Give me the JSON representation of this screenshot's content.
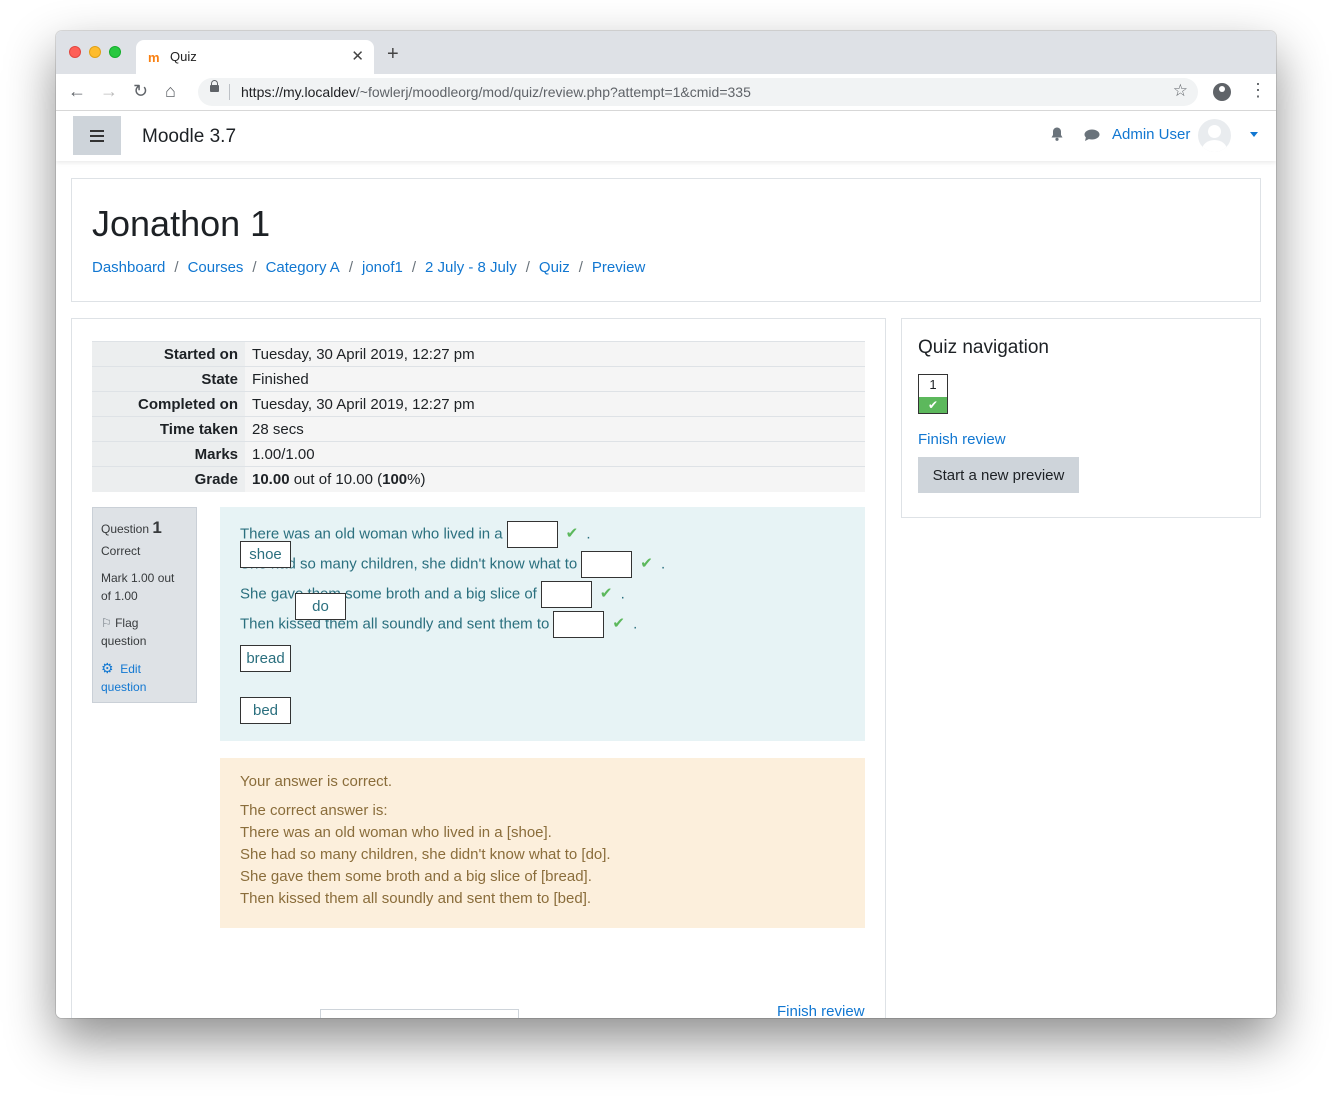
{
  "browser": {
    "tab_title": "Quiz",
    "favicon": "moodle-icon",
    "url_host": "https://my.localdev",
    "url_path": "/~fowlerj/moodleorg/mod/quiz/review.php?attempt=1&cmid=335"
  },
  "navbar": {
    "site_name": "Moodle 3.7",
    "user_name": "Admin User"
  },
  "header": {
    "title": "Jonathon 1",
    "breadcrumb": [
      "Dashboard",
      "Courses",
      "Category A",
      "jonof1",
      "2 July - 8 July",
      "Quiz",
      "Preview"
    ]
  },
  "summary": [
    {
      "label": "Started on",
      "value": "Tuesday, 30 April 2019, 12:27 pm"
    },
    {
      "label": "State",
      "value": "Finished"
    },
    {
      "label": "Completed on",
      "value": "Tuesday, 30 April 2019, 12:27 pm"
    },
    {
      "label": "Time taken",
      "value": "28 secs"
    },
    {
      "label": "Marks",
      "value": "1.00/1.00"
    },
    {
      "label": "Grade",
      "grade_value": "10.00",
      "grade_mid": " out of 10.00 (",
      "grade_pct": "100",
      "grade_end": "%)"
    }
  ],
  "question": {
    "prefix": "Question",
    "number": "1",
    "state": "Correct",
    "mark": "Mark 1.00 out of 1.00",
    "flag": "Flag question",
    "edit": "Edit question",
    "lines": [
      {
        "pre": "There was an old woman who lived in a",
        "post": "."
      },
      {
        "pre": "She had so many children, she didn't know what to",
        "post": "."
      },
      {
        "pre": "She gave them some broth and a big slice of",
        "post": "."
      },
      {
        "pre": "Then kissed them all soundly and sent them to",
        "post": "."
      }
    ],
    "drag_items": [
      "shoe",
      "do",
      "bread",
      "bed"
    ],
    "tick": "✔"
  },
  "outcome": {
    "feedback": "Your answer is correct.",
    "right_label": "The correct answer is:",
    "answers": [
      "There was an old woman who lived in a [shoe].",
      "She had so many children, she didn't know what to [do].",
      "She gave them some broth and a big slice of [bread].",
      "Then kissed them all soundly and sent them to [bed]."
    ]
  },
  "quiz_nav": {
    "title": "Quiz navigation",
    "button_number": "1",
    "finish_review": "Finish review",
    "new_preview": "Start a new preview"
  },
  "footer": {
    "finish_review": "Finish review"
  }
}
